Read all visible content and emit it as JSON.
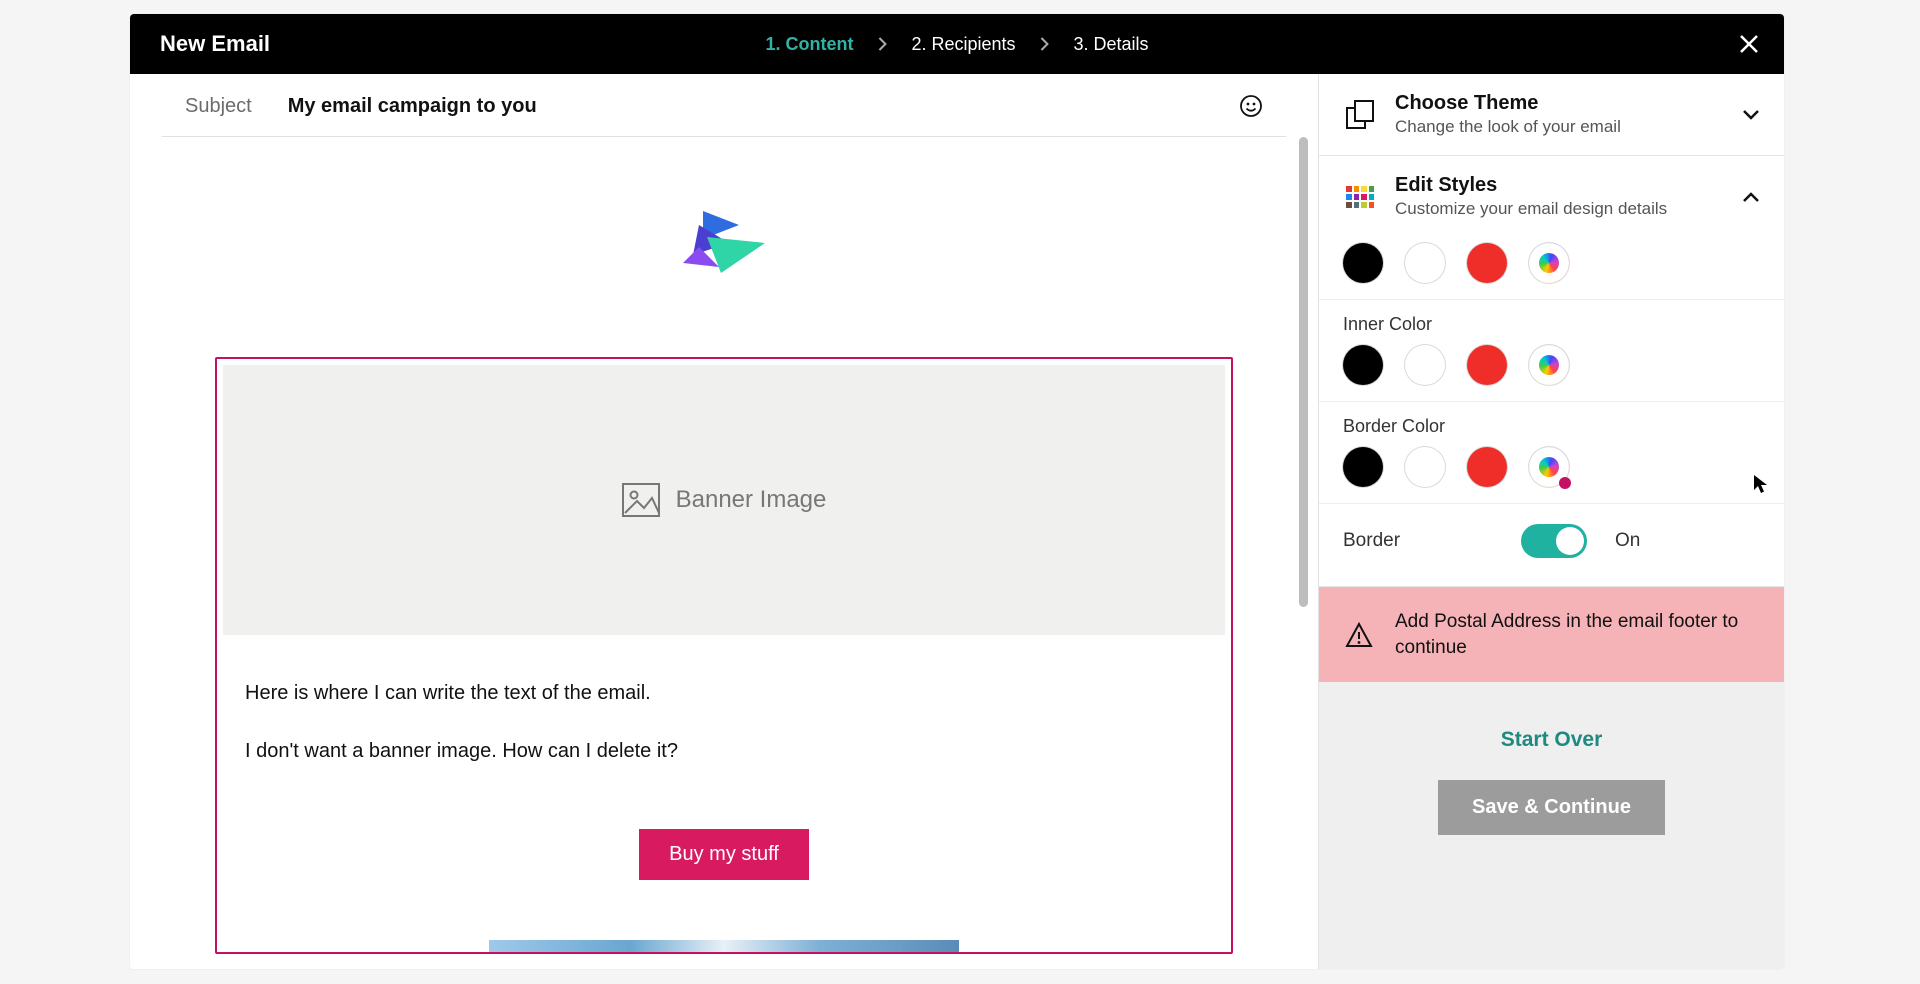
{
  "header": {
    "title": "New Email",
    "steps": [
      "1. Content",
      "2. Recipients",
      "3. Details"
    ],
    "active_step_index": 0
  },
  "subject": {
    "label": "Subject",
    "value": "My email campaign to you"
  },
  "canvas": {
    "banner_placeholder": "Banner Image",
    "paragraph1": "Here is where I can write the text of the email.",
    "paragraph2": "I don't want a banner image. How can I delete it?",
    "cta_label": "Buy my stuff"
  },
  "sidebar": {
    "theme": {
      "title": "Choose Theme",
      "subtitle": "Change the look of your email"
    },
    "styles": {
      "title": "Edit Styles",
      "subtitle": "Customize your email design details"
    },
    "sections": {
      "inner_color": "Inner Color",
      "border_color": "Border Color",
      "border": "Border",
      "border_state": "On"
    },
    "swatches": [
      "#000000",
      "#ffffff",
      "#ef2e2a",
      "custom"
    ],
    "alert": "Add Postal Address in the email footer to continue",
    "start_over": "Start Over",
    "save_continue": "Save & Continue"
  }
}
